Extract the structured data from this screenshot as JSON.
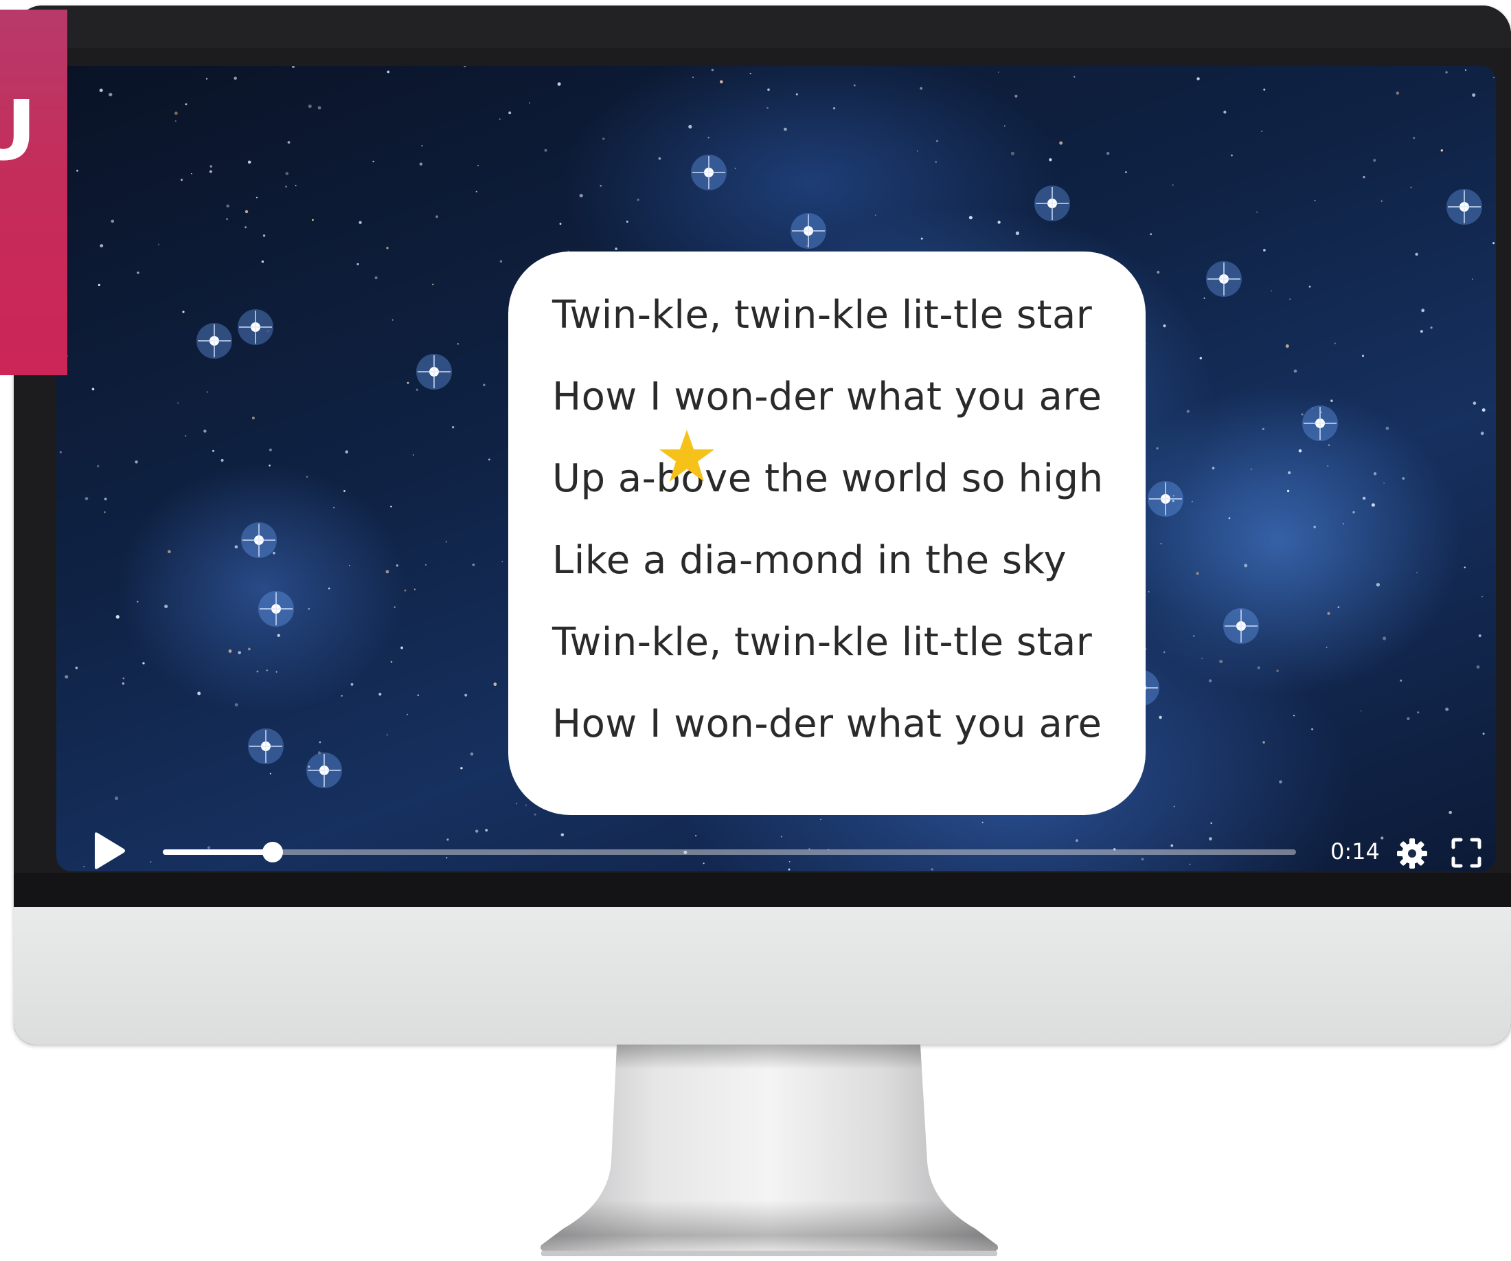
{
  "video": {
    "lyrics": [
      "Twin-kle, twin-kle lit-tle star",
      "How I won-der what you are",
      "Up a-bove the world so high",
      "Like a dia-mond in the sky",
      "Twin-kle, twin-kle lit-tle star",
      "How I won-der what you are"
    ],
    "decoration_icon": "star-icon"
  },
  "player": {
    "current_time": "0:14",
    "progress_fraction": 0.097,
    "play_icon": "play-icon",
    "settings_icon": "gear-icon",
    "fullscreen_icon": "fullscreen-icon"
  },
  "brand": {
    "glyph": "U"
  },
  "colors": {
    "brand_tab": "#c42d5a",
    "star": "#f6c21a",
    "sky": "#16305f"
  }
}
